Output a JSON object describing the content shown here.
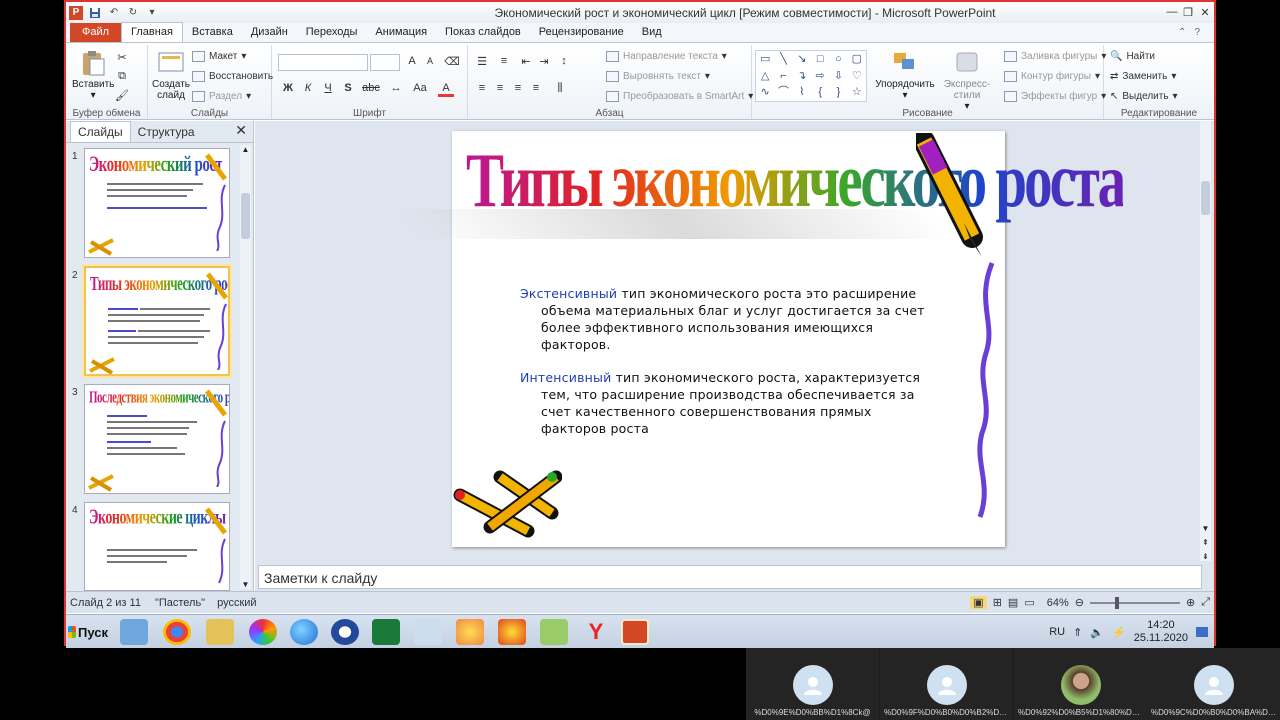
{
  "window": {
    "title": "Экономический рост и экономический цикл [Режим совместимости]  -  Microsoft PowerPoint"
  },
  "tabs": [
    "Файл",
    "Главная",
    "Вставка",
    "Дизайн",
    "Переходы",
    "Анимация",
    "Показ слайдов",
    "Рецензирование",
    "Вид"
  ],
  "active_tab": "Главная",
  "ribbon": {
    "clipboard": {
      "paste": "Вставить",
      "label": "Буфер обмена"
    },
    "slides": {
      "create": "Создать",
      "create2": "слайд",
      "layout": "Макет",
      "reset": "Восстановить",
      "section": "Раздел",
      "label": "Слайды"
    },
    "font": {
      "label": "Шрифт",
      "bold": "Ж",
      "italic": "К",
      "underline": "Ч",
      "strike": "S",
      "abc": "abc",
      "grow": "A",
      "shrink": "A",
      "aa": "Aa",
      "color": "A"
    },
    "paragraph": {
      "text_dir": "Направление текста",
      "align_text": "Выровнять текст",
      "smartart": "Преобразовать в SmartArt",
      "label": "Абзац"
    },
    "drawing": {
      "arrange": "Упорядочить",
      "quick": "Экспресс-стили",
      "fill": "Заливка фигуры",
      "outline": "Контур фигуры",
      "effects": "Эффекты фигур",
      "label": "Рисование"
    },
    "editing": {
      "find": "Найти",
      "replace": "Заменить",
      "select": "Выделить",
      "label": "Редактирование"
    }
  },
  "left_pane": {
    "tabs": [
      "Слайды",
      "Структура"
    ],
    "close": "✕",
    "thumbs": [
      {
        "num": "1",
        "title": "Экономический рост"
      },
      {
        "num": "2",
        "title": "Типы экономического роста"
      },
      {
        "num": "3",
        "title": "Последствия экономического роста"
      },
      {
        "num": "4",
        "title": "Экономические циклы"
      }
    ]
  },
  "slide": {
    "title": "Типы экономического роста",
    "p1_kw": "Экстенсивный",
    "p1_first": " тип экономического  роста  это расширение",
    "p1_rest": "объема материальных благ и услуг достигается за счет более эффективного использования имеющихся факторов.",
    "p2_kw": "Интенсивный",
    "p2_first": " тип экономического  роста, характеризуется",
    "p2_rest": "тем, что расширение производства обеспечивается за счет качественного совершенствования прямых факторов роста"
  },
  "notes_placeholder": "Заметки к слайду",
  "status": {
    "slide": "Слайд 2 из 11",
    "theme": "\"Пастель\"",
    "lang": "русский",
    "zoom": "64%",
    "zoom_fraction": 0.64
  },
  "taskbar": {
    "start": "Пуск",
    "lang": "RU",
    "time": "14:20",
    "date": "25.11.2020"
  },
  "participants": [
    "%D0%9E%D0%BB%D1%8Ck@",
    "%D0%9F%D0%B0%D0%B2%D0%BB...",
    "%D0%92%D0%B5%D1%80%D0%B0...",
    "%D0%9C%D0%B0%D0%BA%D1%81..."
  ],
  "colors": {
    "accent": "#d24726",
    "selected_thumb": "#f2c44f",
    "keyword": "#1f3eb0"
  }
}
